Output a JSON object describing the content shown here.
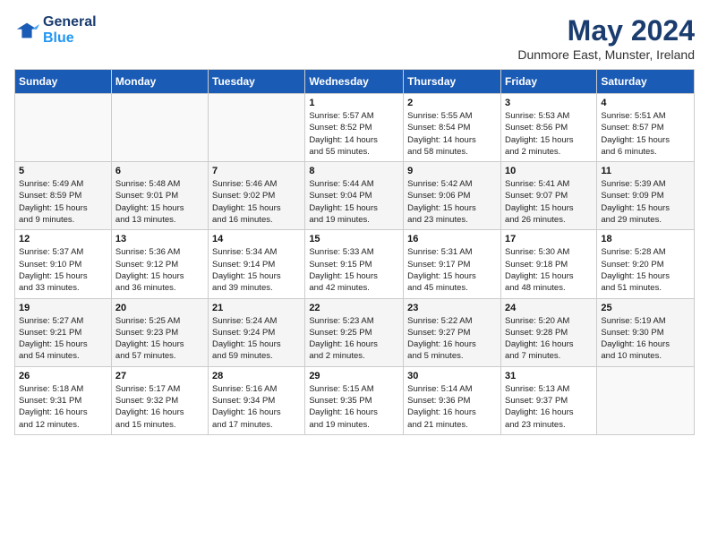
{
  "header": {
    "logo_line1": "General",
    "logo_line2": "Blue",
    "month": "May 2024",
    "location": "Dunmore East, Munster, Ireland"
  },
  "days_of_week": [
    "Sunday",
    "Monday",
    "Tuesday",
    "Wednesday",
    "Thursday",
    "Friday",
    "Saturday"
  ],
  "weeks": [
    [
      {
        "day": "",
        "info": ""
      },
      {
        "day": "",
        "info": ""
      },
      {
        "day": "",
        "info": ""
      },
      {
        "day": "1",
        "info": "Sunrise: 5:57 AM\nSunset: 8:52 PM\nDaylight: 14 hours\nand 55 minutes."
      },
      {
        "day": "2",
        "info": "Sunrise: 5:55 AM\nSunset: 8:54 PM\nDaylight: 14 hours\nand 58 minutes."
      },
      {
        "day": "3",
        "info": "Sunrise: 5:53 AM\nSunset: 8:56 PM\nDaylight: 15 hours\nand 2 minutes."
      },
      {
        "day": "4",
        "info": "Sunrise: 5:51 AM\nSunset: 8:57 PM\nDaylight: 15 hours\nand 6 minutes."
      }
    ],
    [
      {
        "day": "5",
        "info": "Sunrise: 5:49 AM\nSunset: 8:59 PM\nDaylight: 15 hours\nand 9 minutes."
      },
      {
        "day": "6",
        "info": "Sunrise: 5:48 AM\nSunset: 9:01 PM\nDaylight: 15 hours\nand 13 minutes."
      },
      {
        "day": "7",
        "info": "Sunrise: 5:46 AM\nSunset: 9:02 PM\nDaylight: 15 hours\nand 16 minutes."
      },
      {
        "day": "8",
        "info": "Sunrise: 5:44 AM\nSunset: 9:04 PM\nDaylight: 15 hours\nand 19 minutes."
      },
      {
        "day": "9",
        "info": "Sunrise: 5:42 AM\nSunset: 9:06 PM\nDaylight: 15 hours\nand 23 minutes."
      },
      {
        "day": "10",
        "info": "Sunrise: 5:41 AM\nSunset: 9:07 PM\nDaylight: 15 hours\nand 26 minutes."
      },
      {
        "day": "11",
        "info": "Sunrise: 5:39 AM\nSunset: 9:09 PM\nDaylight: 15 hours\nand 29 minutes."
      }
    ],
    [
      {
        "day": "12",
        "info": "Sunrise: 5:37 AM\nSunset: 9:10 PM\nDaylight: 15 hours\nand 33 minutes."
      },
      {
        "day": "13",
        "info": "Sunrise: 5:36 AM\nSunset: 9:12 PM\nDaylight: 15 hours\nand 36 minutes."
      },
      {
        "day": "14",
        "info": "Sunrise: 5:34 AM\nSunset: 9:14 PM\nDaylight: 15 hours\nand 39 minutes."
      },
      {
        "day": "15",
        "info": "Sunrise: 5:33 AM\nSunset: 9:15 PM\nDaylight: 15 hours\nand 42 minutes."
      },
      {
        "day": "16",
        "info": "Sunrise: 5:31 AM\nSunset: 9:17 PM\nDaylight: 15 hours\nand 45 minutes."
      },
      {
        "day": "17",
        "info": "Sunrise: 5:30 AM\nSunset: 9:18 PM\nDaylight: 15 hours\nand 48 minutes."
      },
      {
        "day": "18",
        "info": "Sunrise: 5:28 AM\nSunset: 9:20 PM\nDaylight: 15 hours\nand 51 minutes."
      }
    ],
    [
      {
        "day": "19",
        "info": "Sunrise: 5:27 AM\nSunset: 9:21 PM\nDaylight: 15 hours\nand 54 minutes."
      },
      {
        "day": "20",
        "info": "Sunrise: 5:25 AM\nSunset: 9:23 PM\nDaylight: 15 hours\nand 57 minutes."
      },
      {
        "day": "21",
        "info": "Sunrise: 5:24 AM\nSunset: 9:24 PM\nDaylight: 15 hours\nand 59 minutes."
      },
      {
        "day": "22",
        "info": "Sunrise: 5:23 AM\nSunset: 9:25 PM\nDaylight: 16 hours\nand 2 minutes."
      },
      {
        "day": "23",
        "info": "Sunrise: 5:22 AM\nSunset: 9:27 PM\nDaylight: 16 hours\nand 5 minutes."
      },
      {
        "day": "24",
        "info": "Sunrise: 5:20 AM\nSunset: 9:28 PM\nDaylight: 16 hours\nand 7 minutes."
      },
      {
        "day": "25",
        "info": "Sunrise: 5:19 AM\nSunset: 9:30 PM\nDaylight: 16 hours\nand 10 minutes."
      }
    ],
    [
      {
        "day": "26",
        "info": "Sunrise: 5:18 AM\nSunset: 9:31 PM\nDaylight: 16 hours\nand 12 minutes."
      },
      {
        "day": "27",
        "info": "Sunrise: 5:17 AM\nSunset: 9:32 PM\nDaylight: 16 hours\nand 15 minutes."
      },
      {
        "day": "28",
        "info": "Sunrise: 5:16 AM\nSunset: 9:34 PM\nDaylight: 16 hours\nand 17 minutes."
      },
      {
        "day": "29",
        "info": "Sunrise: 5:15 AM\nSunset: 9:35 PM\nDaylight: 16 hours\nand 19 minutes."
      },
      {
        "day": "30",
        "info": "Sunrise: 5:14 AM\nSunset: 9:36 PM\nDaylight: 16 hours\nand 21 minutes."
      },
      {
        "day": "31",
        "info": "Sunrise: 5:13 AM\nSunset: 9:37 PM\nDaylight: 16 hours\nand 23 minutes."
      },
      {
        "day": "",
        "info": ""
      }
    ]
  ]
}
